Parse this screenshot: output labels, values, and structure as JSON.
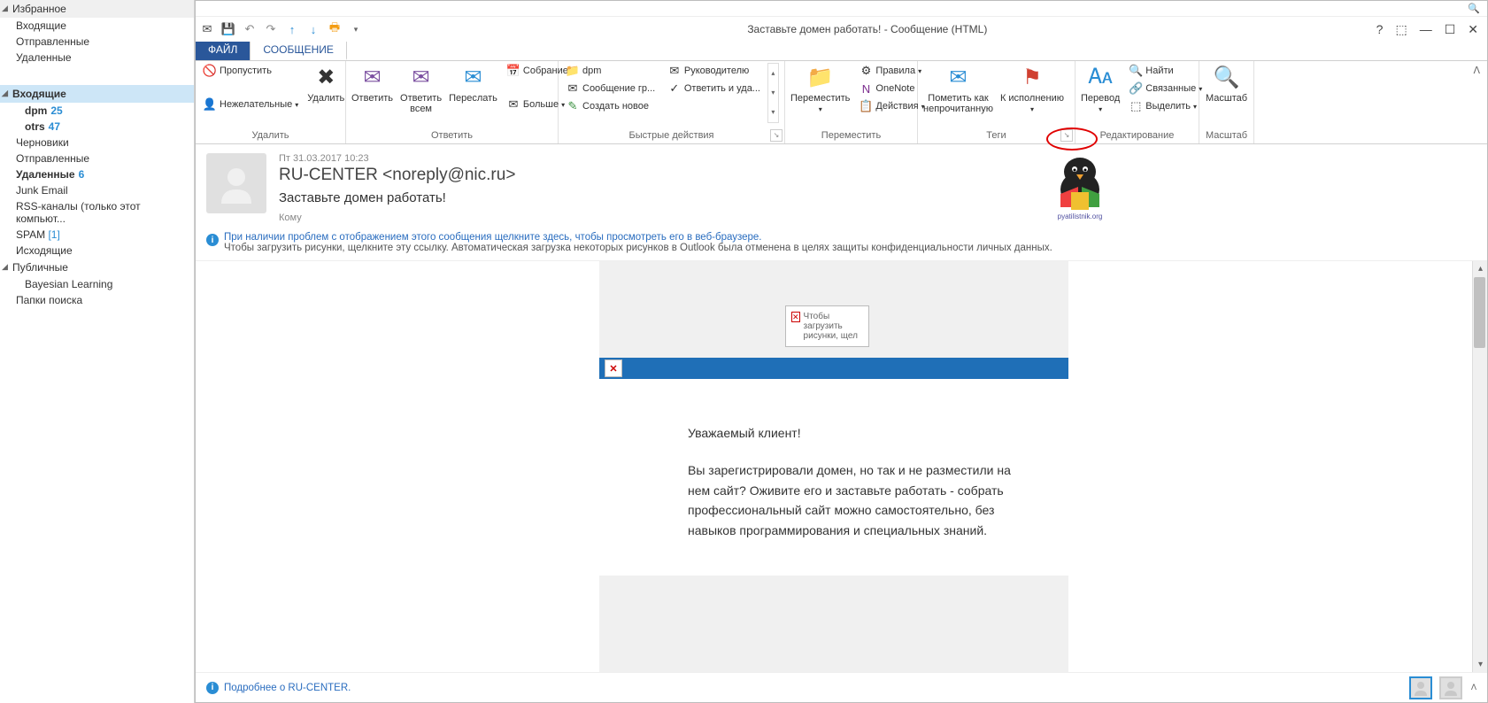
{
  "left_panel": {
    "favorites": {
      "header": "Избранное",
      "items": [
        {
          "label": "Входящие"
        },
        {
          "label": "Отправленные"
        },
        {
          "label": "Удаленные"
        }
      ]
    },
    "mailbox": {
      "inbox_header": "Входящие",
      "items": [
        {
          "label": "dpm",
          "count": "25",
          "nested": true
        },
        {
          "label": "otrs",
          "count": "47",
          "nested": true
        },
        {
          "label": "Черновики"
        },
        {
          "label": "Отправленные"
        },
        {
          "label": "Удаленные",
          "count": "6"
        },
        {
          "label": "Junk Email"
        },
        {
          "label": "RSS-каналы (только этот компьют..."
        },
        {
          "label": "SPAM",
          "count": "[1]"
        },
        {
          "label": "Исходящие"
        }
      ]
    },
    "public": {
      "header": "Публичные",
      "items": [
        {
          "label": "Bayesian Learning",
          "nested": true
        }
      ]
    },
    "search_folders": "Папки поиска"
  },
  "window": {
    "title": "Заставьте домен работать! - Сообщение (HTML)"
  },
  "tabs": {
    "file": "ФАЙЛ",
    "message": "СООБЩЕНИЕ"
  },
  "ribbon": {
    "delete": {
      "skip": "Пропустить",
      "junk": "Нежелательные",
      "delete": "Удалить",
      "group": "Удалить"
    },
    "respond": {
      "reply": "Ответить",
      "reply_all": "Ответить\nвсем",
      "forward": "Переслать",
      "meeting": "Собрание",
      "more": "Больше",
      "group": "Ответить"
    },
    "quick": {
      "dpm": "dpm",
      "msg": "Сообщение гр...",
      "create": "Создать новое",
      "manager": "Руководителю",
      "reply_del": "Ответить и уда...",
      "group": "Быстрые действия"
    },
    "move": {
      "move": "Переместить",
      "rules": "Правила",
      "onenote": "OneNote",
      "actions": "Действия",
      "group": "Переместить"
    },
    "tags": {
      "unread": "Пометить как\nнепрочитанную",
      "followup": "К исполнению",
      "group": "Теги"
    },
    "edit": {
      "translate": "Перевод",
      "find": "Найти",
      "related": "Связанные",
      "select": "Выделить",
      "group": "Редактирование"
    },
    "zoom": {
      "zoom": "Масштаб",
      "group": "Масштаб"
    }
  },
  "header": {
    "date": "Пт 31.03.2017 10:23",
    "from": "RU-CENTER <noreply@nic.ru>",
    "subject": "Заставьте домен работать!",
    "to_label": "Кому"
  },
  "info_bar": {
    "line1": "При наличии проблем с отображением этого сообщения щелкните здесь, чтобы просмотреть его в веб-браузере.",
    "line2": "Чтобы загрузить рисунки, щелкните эту ссылку. Автоматическая загрузка некоторых рисунков в Outlook была отменена в целях защиты конфиденциальности личных данных."
  },
  "body": {
    "blocked_text": "Чтобы загрузить рисунки, щел",
    "greeting": "Уважаемый клиент!",
    "para": "Вы зарегистрировали домен, но так и не разместили на нем сайт? Оживите его и заставьте работать - собрать профессиональный сайт можно самостоятельно, без навыков программирования и специальных знаний."
  },
  "footer": {
    "more": "Подробнее о RU-CENTER."
  },
  "watermark": "pyatilistnik.org"
}
